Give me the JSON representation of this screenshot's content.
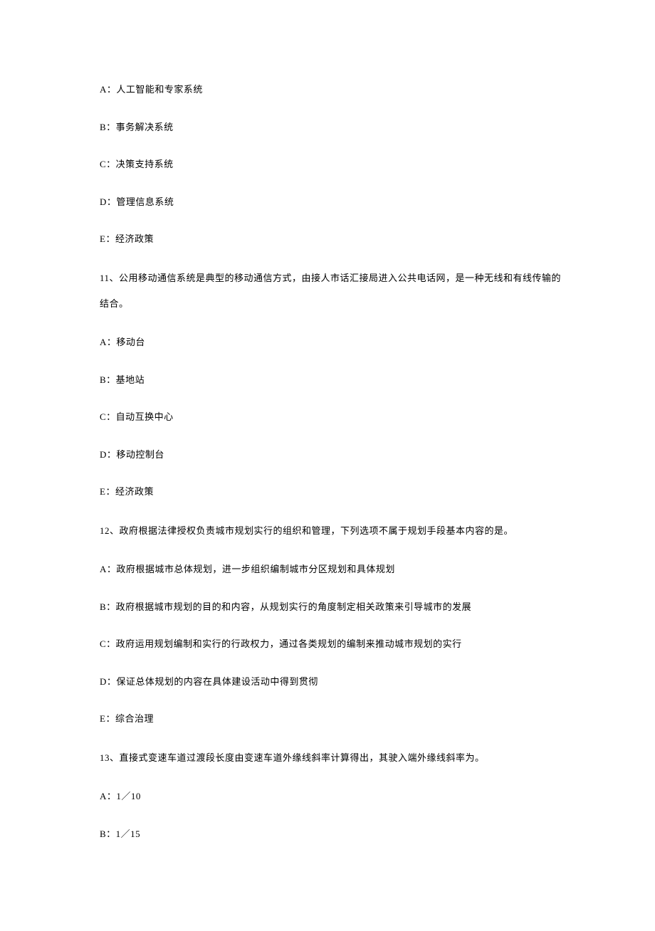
{
  "q10": {
    "options": {
      "A": "A：人工智能和专家系统",
      "B": "B：事务解决系统",
      "C": "C：决策支持系统",
      "D": "D：管理信息系统",
      "E": "E：经济政策"
    }
  },
  "q11": {
    "stem": "11、公用移动通信系统是典型的移动通信方式，由接人市话汇接局进入公共电话网，是一种无线和有线传输的结合。",
    "options": {
      "A": "A：移动台",
      "B": "B：基地站",
      "C": "C：自动互换中心",
      "D": "D：移动控制台",
      "E": "E：经济政策"
    }
  },
  "q12": {
    "stem": "12、政府根据法律授权负责城市规划实行的组织和管理，下列选项不属于规划手段基本内容的是。",
    "options": {
      "A": "A：政府根据城市总体规划，进一步组织编制城市分区规划和具体规划",
      "B": "B：政府根据城市规划的目的和内容，从规划实行的角度制定相关政策来引导城市的发展",
      "C": "C：政府运用规划编制和实行的行政权力，通过各类规划的编制来推动城市规划的实行",
      "D": "D：保证总体规划的内容在具体建设活动中得到贯彻",
      "E": "E：综合治理"
    }
  },
  "q13": {
    "stem": "13、直接式变速车道过渡段长度由变速车道外缘线斜率计算得出，其驶入端外缘线斜率为。",
    "options": {
      "A": "A：1／10",
      "B": "B：1／15"
    }
  }
}
